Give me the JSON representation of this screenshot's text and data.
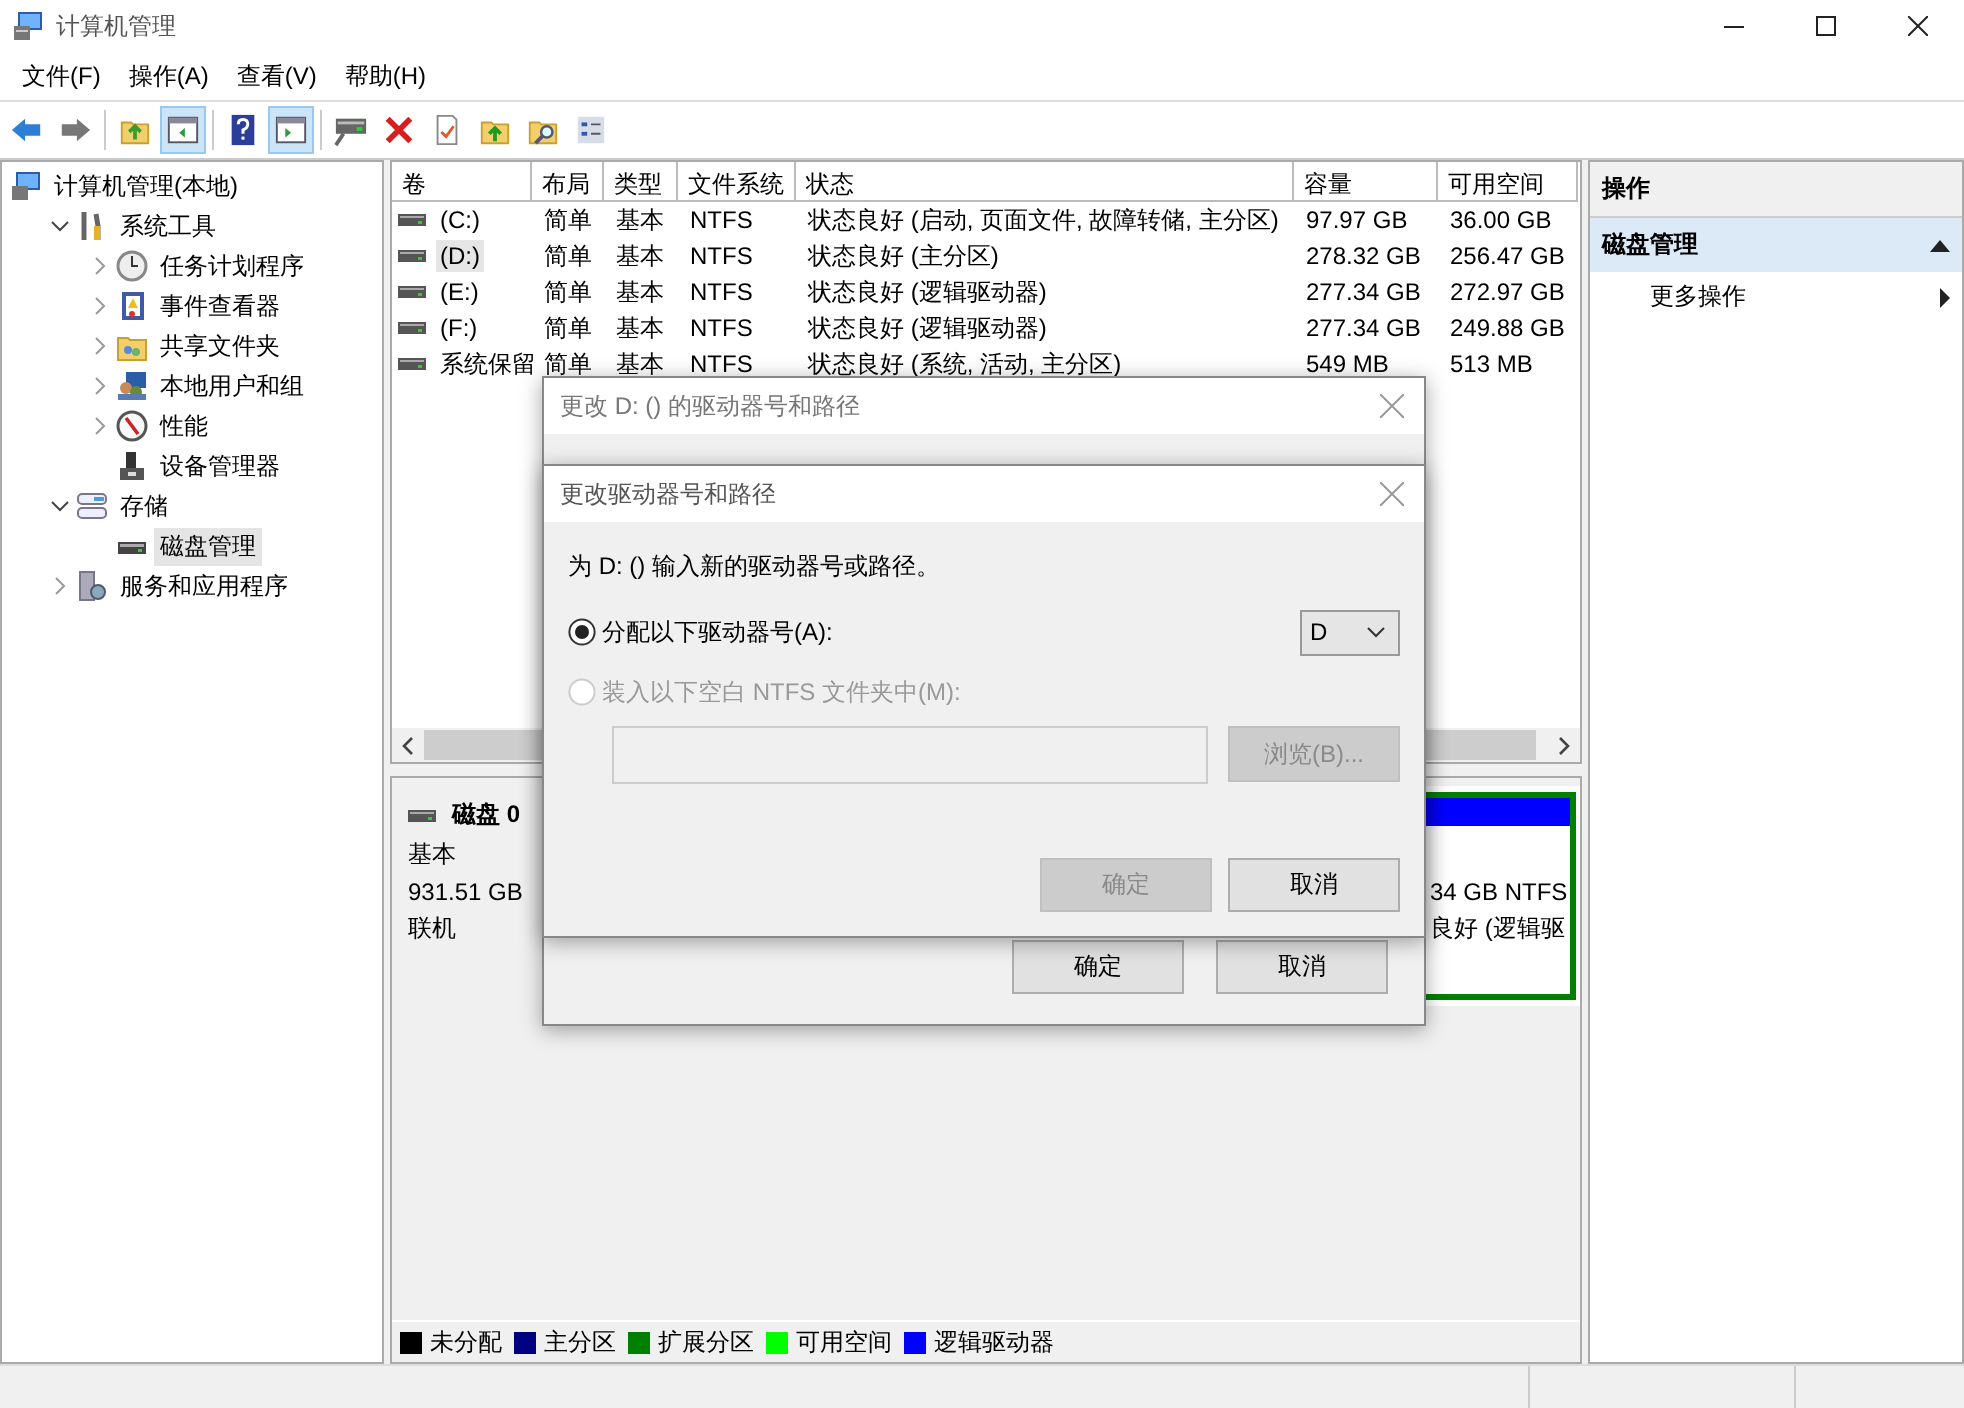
{
  "window": {
    "title": "计算机管理"
  },
  "menu": [
    "文件(F)",
    "操作(A)",
    "查看(V)",
    "帮助(H)"
  ],
  "toolbar": [
    {
      "kind": "action"
    },
    {
      "kind": "action"
    },
    {
      "kind": "action"
    },
    {
      "kind": "toggle",
      "on": true
    },
    {
      "kind": "action"
    },
    {
      "kind": "toggle",
      "on": true
    },
    {
      "kind": "action"
    },
    {
      "kind": "action"
    },
    {
      "kind": "action"
    },
    {
      "kind": "action"
    },
    {
      "kind": "action"
    },
    {
      "kind": "action"
    }
  ],
  "tree": [
    {
      "label": "计算机管理(本地)",
      "has_children": false,
      "expanded": false,
      "selected": false,
      "children": [
        {
          "label": "系统工具",
          "has_children": true,
          "expanded": true,
          "selected": false,
          "children": [
            {
              "label": "任务计划程序",
              "has_children": true,
              "expanded": false,
              "selected": false
            },
            {
              "label": "事件查看器",
              "has_children": true,
              "expanded": false,
              "selected": false
            },
            {
              "label": "共享文件夹",
              "has_children": true,
              "expanded": false,
              "selected": false
            },
            {
              "label": "本地用户和组",
              "has_children": true,
              "expanded": false,
              "selected": false
            },
            {
              "label": "性能",
              "has_children": true,
              "expanded": false,
              "selected": false
            },
            {
              "label": "设备管理器",
              "has_children": false,
              "expanded": false,
              "selected": false
            }
          ]
        },
        {
          "label": "存储",
          "has_children": true,
          "expanded": true,
          "selected": false,
          "children": [
            {
              "label": "磁盘管理",
              "has_children": false,
              "expanded": false,
              "selected": true
            }
          ]
        },
        {
          "label": "服务和应用程序",
          "has_children": true,
          "expanded": false,
          "selected": false
        }
      ]
    }
  ],
  "table": {
    "columns": [
      "卷",
      "布局",
      "类型",
      "文件系统",
      "状态",
      "容量",
      "可用空间"
    ],
    "rows": [
      {
        "selected": false,
        "cells": [
          "(C:)",
          "简单",
          "基本",
          "NTFS",
          "状态良好 (启动, 页面文件, 故障转储, 主分区)",
          "97.97 GB",
          "36.00 GB"
        ]
      },
      {
        "selected": true,
        "cells": [
          "(D:)",
          "简单",
          "基本",
          "NTFS",
          "状态良好 (主分区)",
          "278.32 GB",
          "256.47 GB"
        ]
      },
      {
        "selected": false,
        "cells": [
          "(E:)",
          "简单",
          "基本",
          "NTFS",
          "状态良好 (逻辑驱动器)",
          "277.34 GB",
          "272.97 GB"
        ]
      },
      {
        "selected": false,
        "cells": [
          "(F:)",
          "简单",
          "基本",
          "NTFS",
          "状态良好 (逻辑驱动器)",
          "277.34 GB",
          "249.88 GB"
        ]
      },
      {
        "selected": false,
        "cells": [
          "系统保留",
          "简单",
          "基本",
          "NTFS",
          "状态良好 (系统, 活动, 主分区)",
          "549 MB",
          "513 MB"
        ]
      }
    ]
  },
  "disk": {
    "name": "磁盘 0",
    "type": "基本",
    "size": "931.51 GB",
    "status": "联机",
    "partition": {
      "color": "#0000ff",
      "lines": [
        "34 GB NTFS",
        "良好 (逻辑驱"
      ]
    }
  },
  "legend": [
    {
      "label": "未分配",
      "color": "#000000"
    },
    {
      "label": "主分区",
      "color": "#000080"
    },
    {
      "label": "扩展分区",
      "color": "#008000"
    },
    {
      "label": "可用空间",
      "color": "#00ff00"
    },
    {
      "label": "逻辑驱动器",
      "color": "#0000ff"
    }
  ],
  "actions": {
    "title": "操作",
    "section": "磁盘管理",
    "items": [
      "更多操作"
    ]
  },
  "outer_dialog": {
    "title": "更改 D: () 的驱动器号和路径",
    "buttons": [
      {
        "label": "确定",
        "disabled": false
      },
      {
        "label": "取消",
        "disabled": false
      }
    ]
  },
  "inner_dialog": {
    "title": "更改驱动器号和路径",
    "prompt": "为 D: () 输入新的驱动器号或路径。",
    "options": [
      {
        "kind": "letter",
        "label": "分配以下驱动器号(A):",
        "selected": true,
        "disabled": false,
        "value": "D"
      },
      {
        "kind": "folder",
        "label": "装入以下空白 NTFS 文件夹中(M):",
        "selected": false,
        "disabled": true,
        "button": "浏览(B)..."
      }
    ],
    "buttons": [
      {
        "label": "确定",
        "disabled": true
      },
      {
        "label": "取消",
        "disabled": false
      }
    ]
  }
}
